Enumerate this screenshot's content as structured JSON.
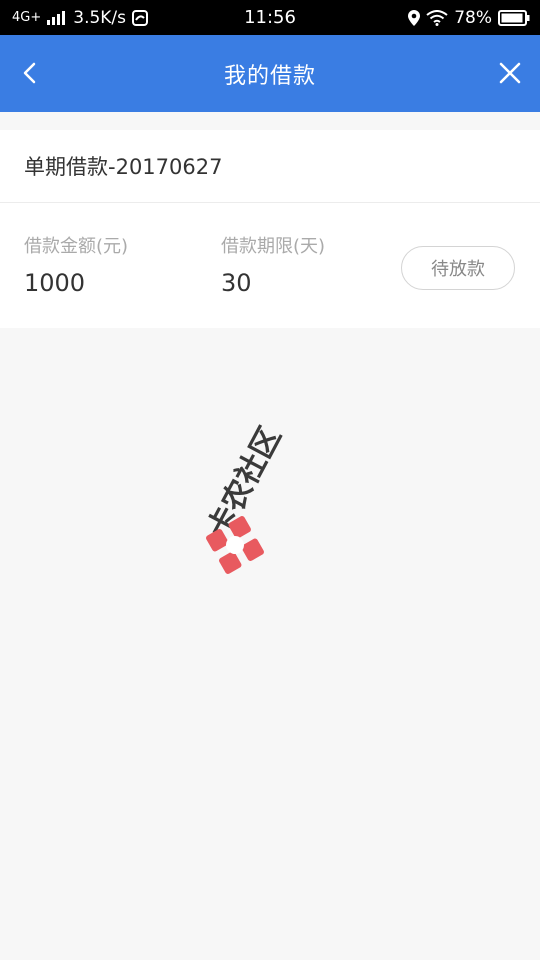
{
  "status_bar": {
    "network": "4G+",
    "speed": "3.5K/s",
    "time": "11:56",
    "battery": "78%"
  },
  "nav": {
    "title": "我的借款"
  },
  "loan": {
    "name": "单期借款-20170627",
    "amount_label": "借款金额(元)",
    "amount_value": "1000",
    "term_label": "借款期限(天)",
    "term_value": "30",
    "status": "待放款"
  },
  "watermark": {
    "text": "卡农社区"
  },
  "colors": {
    "nav_bg": "#3a7de3",
    "page_bg": "#f7f7f7",
    "watermark_red": "#e85a5f"
  }
}
